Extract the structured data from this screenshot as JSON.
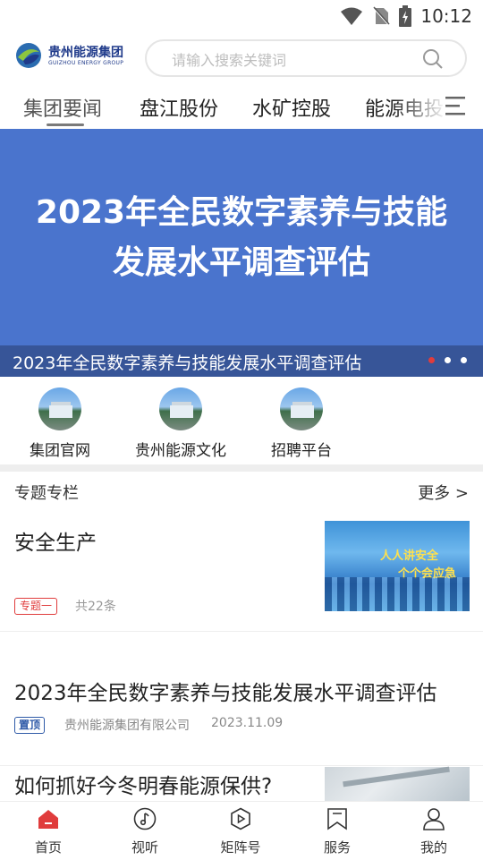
{
  "status_bar": {
    "time": "10:12"
  },
  "header": {
    "logo_cn": "贵州能源集团",
    "logo_en": "GUIZHOU ENERGY GROUP",
    "search_placeholder": "请输入搜索关键词"
  },
  "tabs": [
    {
      "label": "集团要闻",
      "active": true
    },
    {
      "label": "盘江股份",
      "active": false
    },
    {
      "label": "水矿控股",
      "active": false
    },
    {
      "label": "能源电投",
      "active": false
    }
  ],
  "banner": {
    "title_line1": "2023年全民数字素养与技能",
    "title_line2": "发展水平调查评估",
    "caption": "2023年全民数字素养与技能发展水平调查评估",
    "slide_count": 3,
    "active_slide": 1,
    "background_color": "#4a74cd"
  },
  "quick_links": [
    {
      "label": "集团官网"
    },
    {
      "label": "贵州能源文化"
    },
    {
      "label": "招聘平台"
    }
  ],
  "section": {
    "title": "专题专栏",
    "more": "更多 >"
  },
  "feed": [
    {
      "title": "安全生产",
      "badge": "专题一",
      "count": "共22条",
      "thumb_text_1": "人人讲安全",
      "thumb_text_2": "个个会应急"
    },
    {
      "title": "2023年全民数字素养与技能发展水平调查评估",
      "badge": "置顶",
      "source": "贵州能源集团有限公司",
      "date": "2023.11.09"
    },
    {
      "title": "如何抓好今冬明春能源保供?"
    }
  ],
  "bottom_nav": [
    {
      "label": "首页",
      "icon": "home-icon",
      "active": true
    },
    {
      "label": "视听",
      "icon": "music-icon",
      "active": false
    },
    {
      "label": "矩阵号",
      "icon": "play-icon",
      "active": false
    },
    {
      "label": "服务",
      "icon": "bookmark-icon",
      "active": false
    },
    {
      "label": "我的",
      "icon": "user-icon",
      "active": false
    }
  ],
  "colors": {
    "accent_red": "#e03c3c",
    "badge_blue": "#2f5aa8"
  }
}
